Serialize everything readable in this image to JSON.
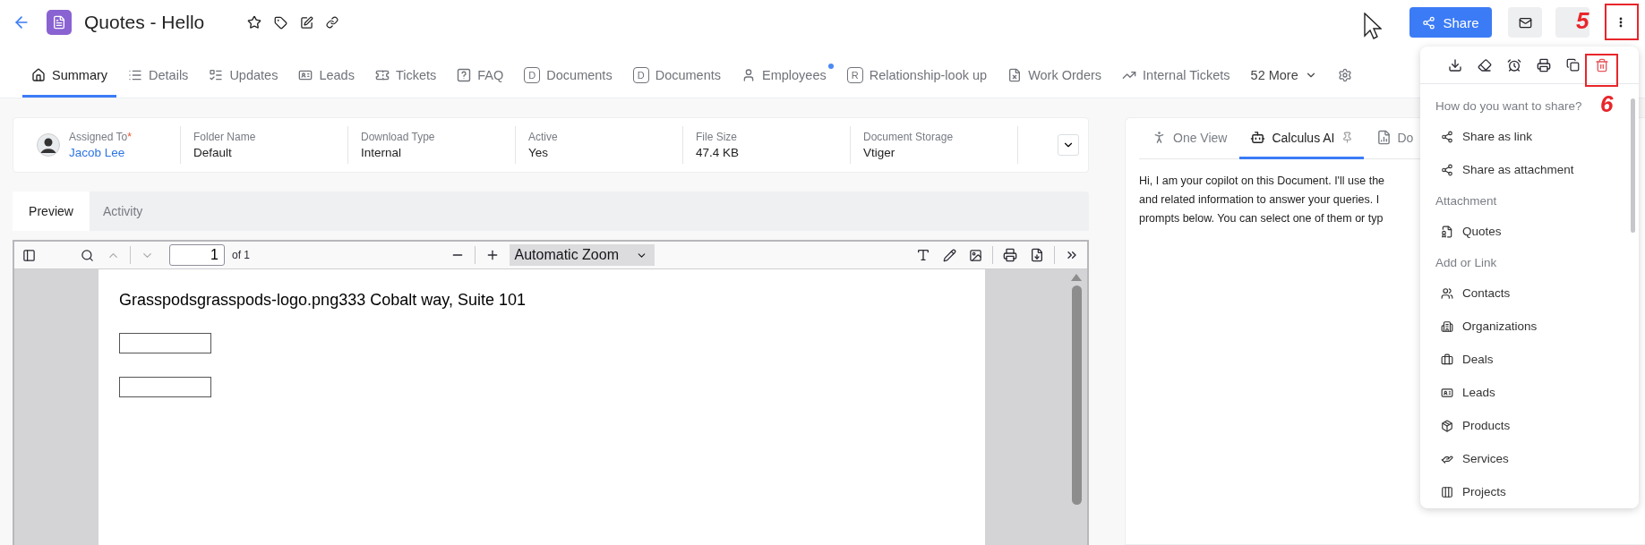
{
  "header": {
    "title": "Quotes - Hello",
    "share_button": "Share"
  },
  "tabs": [
    {
      "label": "Summary",
      "selected": true
    },
    {
      "label": "Details",
      "selected": false
    },
    {
      "label": "Updates",
      "selected": false
    },
    {
      "label": "Leads",
      "selected": false
    },
    {
      "label": "Tickets",
      "selected": false
    },
    {
      "label": "FAQ",
      "selected": false
    },
    {
      "label": "Documents",
      "letter": "D",
      "selected": false
    },
    {
      "label": "Documents",
      "letter": "D",
      "selected": false
    },
    {
      "label": "Employees",
      "selected": false,
      "notification": true
    },
    {
      "label": "Relationship-look up",
      "letter": "R",
      "selected": false
    },
    {
      "label": "Work Orders",
      "selected": false
    },
    {
      "label": "Internal Tickets",
      "selected": false
    }
  ],
  "more_tabs": "52 More",
  "summary_fields": [
    {
      "kind": "user",
      "label": "Assigned To",
      "required_mark": "*",
      "value": "Jacob Lee"
    },
    {
      "kind": "text",
      "label": "Folder Name",
      "value": "Default"
    },
    {
      "kind": "text",
      "label": "Download Type",
      "value": "Internal"
    },
    {
      "kind": "text",
      "label": "Active",
      "value": "Yes"
    },
    {
      "kind": "text",
      "label": "File Size",
      "value": "47.4 KB"
    },
    {
      "kind": "text",
      "label": "Document Storage",
      "value": "Vtiger"
    }
  ],
  "preview_tabs": [
    {
      "label": "Preview",
      "selected": true
    },
    {
      "label": "Activity",
      "selected": false
    }
  ],
  "pdf_viewer": {
    "page": "1",
    "page_count": "of 1",
    "zoom": "Automatic Zoom",
    "content": "Grasspodsgrasspods-logo.png333 Cobalt way, Suite 101"
  },
  "side_panel": {
    "tabs": [
      {
        "label": "One View",
        "selected": false,
        "pinned": false
      },
      {
        "label": "Calculus AI",
        "selected": true,
        "pinned": true
      },
      {
        "label": "Do",
        "selected": false,
        "pinned": false
      }
    ],
    "message_lines": [
      "Hi, I am your copilot on this Document. I'll use the",
      "and related information to answer your queries. I",
      "prompts below. You can select one of them or typ"
    ]
  },
  "share_menu": {
    "items": [
      {
        "kind": "heading",
        "label": "How do you want to share?"
      },
      {
        "kind": "item",
        "label": "Share as link"
      },
      {
        "kind": "item",
        "label": "Share as attachment"
      },
      {
        "kind": "heading",
        "label": "Attachment"
      },
      {
        "kind": "item",
        "label": "Quotes"
      },
      {
        "kind": "heading",
        "label": "Add or Link"
      },
      {
        "kind": "item",
        "label": "Contacts"
      },
      {
        "kind": "item",
        "label": "Organizations"
      },
      {
        "kind": "item",
        "label": "Deals"
      },
      {
        "kind": "item",
        "label": "Leads"
      },
      {
        "kind": "item",
        "label": "Products"
      },
      {
        "kind": "item",
        "label": "Services"
      },
      {
        "kind": "item",
        "label": "Projects"
      }
    ]
  },
  "annotations": [
    {
      "label": "5"
    },
    {
      "label": "6"
    }
  ]
}
